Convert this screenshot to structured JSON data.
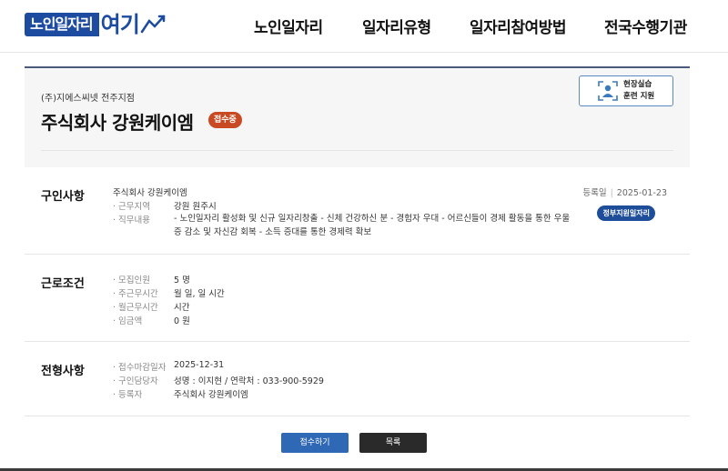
{
  "header": {
    "logo_main": "노인일자리",
    "logo_accent": "여기",
    "nav": [
      "노인일자리",
      "일자리유형",
      "일자리참여방법",
      "전국수행기관"
    ]
  },
  "panel": {
    "branch": "(주)지에스씨넷 전주지점",
    "title": "주식회사 강원케이엠",
    "status": "접수중",
    "training_line1": "현장실습",
    "training_line2": "훈련 지원"
  },
  "recruit": {
    "section_title": "구인사항",
    "company": "주식회사 강원케이엠",
    "work_area_label": "· 근무지역",
    "work_area": "강원 원주시",
    "duty_label": "· 직무내용",
    "duty": "- 노인일자리 활성화 및 신규 일자리창출 - 신체 건강하신 분 - 경험자 우대   - 어르신들이 경제 활동을 통한 우울증 감소 및 자신감 회복 - 소득 증대를 통한 경제력 확보",
    "reg_label": "등록일",
    "reg_date": "2025-01-23",
    "badge": "정부지원일자리"
  },
  "conditions": {
    "section_title": "근로조건",
    "rows": [
      {
        "label": "· 모집인원",
        "value": "5 명"
      },
      {
        "label": "· 주근무시간",
        "value": "월 일, 일 시간"
      },
      {
        "label": "· 월근무시간",
        "value": "시간"
      },
      {
        "label": "· 임금액",
        "value": "0 원"
      }
    ]
  },
  "selection": {
    "section_title": "전형사항",
    "rows": [
      {
        "label": "· 접수마감일자",
        "value": "2025-12-31"
      },
      {
        "label": "· 구인담당자",
        "value": "성명 : 이지현 / 연락처 : 033-900-5929"
      },
      {
        "label": "· 등록자",
        "value": "주식회사 강원케이엠"
      }
    ]
  },
  "buttons": {
    "apply": "접수하기",
    "list": "목록"
  },
  "colors": {
    "brand": "#1c4ba0",
    "status": "#c94a22",
    "apply": "#2f68b4",
    "badge": "#1e4e9a"
  }
}
